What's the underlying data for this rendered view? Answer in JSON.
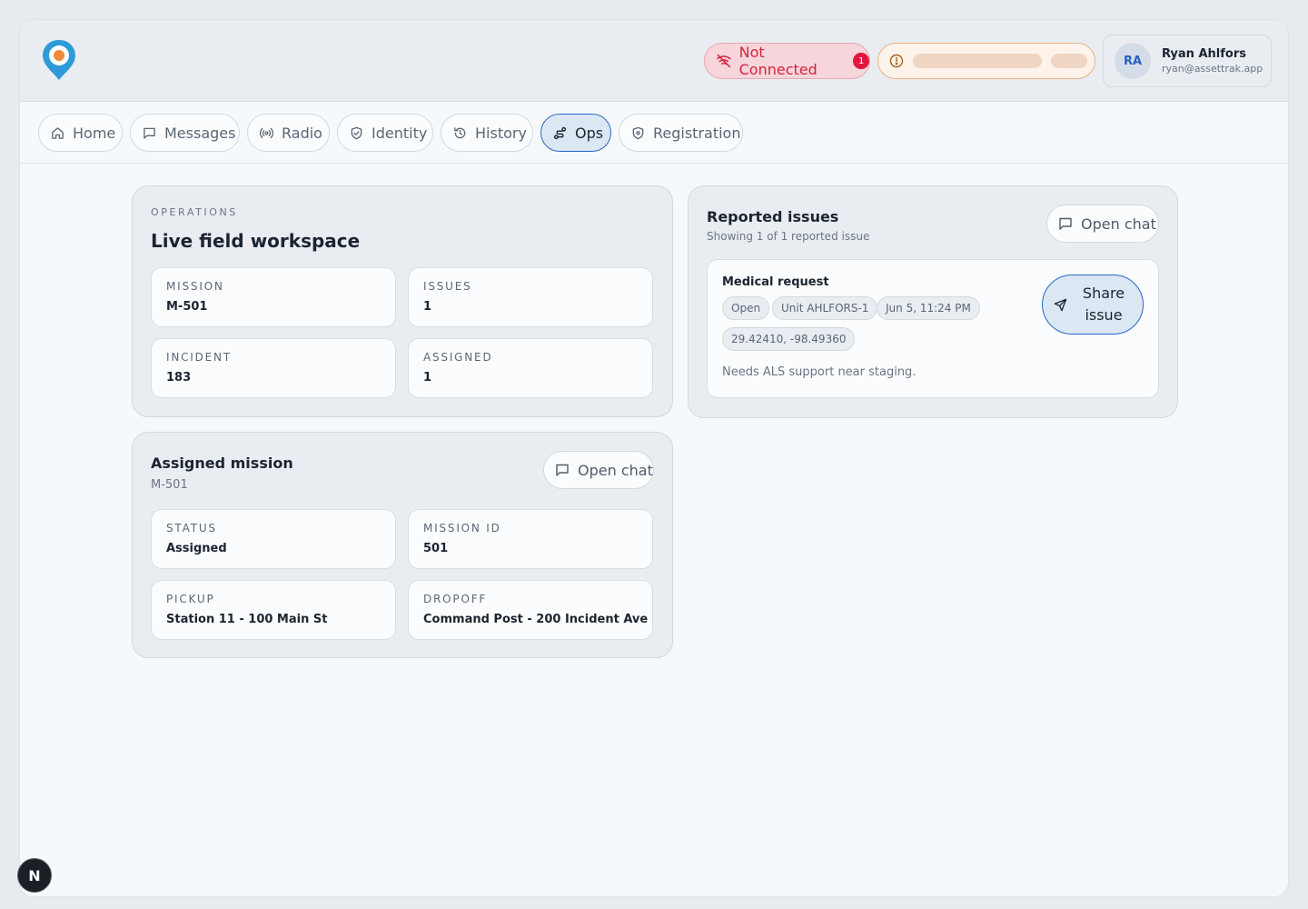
{
  "header": {
    "connection_status": "Not Connected",
    "connection_count": "1",
    "user": {
      "initials": "RA",
      "name": "Ryan Ahlfors",
      "email": "ryan@assettrak.app"
    }
  },
  "tabs": [
    {
      "label": "Home",
      "icon": "home-icon"
    },
    {
      "label": "Messages",
      "icon": "message-icon"
    },
    {
      "label": "Radio",
      "icon": "radio-icon"
    },
    {
      "label": "Identity",
      "icon": "shield-check-icon"
    },
    {
      "label": "History",
      "icon": "history-icon"
    },
    {
      "label": "Ops",
      "icon": "route-icon",
      "active": true
    },
    {
      "label": "Registration",
      "icon": "shield-plus-icon"
    }
  ],
  "operations": {
    "eyebrow": "OPERATIONS",
    "title": "Live field workspace",
    "stats": [
      {
        "label": "MISSION",
        "value": "M-501"
      },
      {
        "label": "ISSUES",
        "value": "1"
      },
      {
        "label": "INCIDENT",
        "value": "183"
      },
      {
        "label": "ASSIGNED",
        "value": "1"
      }
    ]
  },
  "mission": {
    "title": "Assigned mission",
    "subtitle": "M-501",
    "chat_label": "Open chat",
    "stats": [
      {
        "label": "STATUS",
        "value": "Assigned"
      },
      {
        "label": "MISSION ID",
        "value": "501"
      },
      {
        "label": "PICKUP",
        "value": "Station 11 - 100 Main St"
      },
      {
        "label": "DROPOFF",
        "value": "Command Post - 200 Incident Ave"
      }
    ]
  },
  "issues": {
    "title": "Reported issues",
    "subtitle": "Showing 1 of 1 reported issue",
    "chat_label": "Open chat",
    "items": [
      {
        "title": "Medical request",
        "chips": [
          "Open",
          "Unit AHLFORS-1",
          "Jun 5, 11:24 PM",
          "29.42410, -98.49360"
        ],
        "description": "Needs ALS support near staging.",
        "share_label": "Share issue"
      }
    ]
  },
  "dev_badge": "N",
  "colors": {
    "accent": "#2a68c7",
    "danger": "#e1163c",
    "warning": "#eab184"
  }
}
